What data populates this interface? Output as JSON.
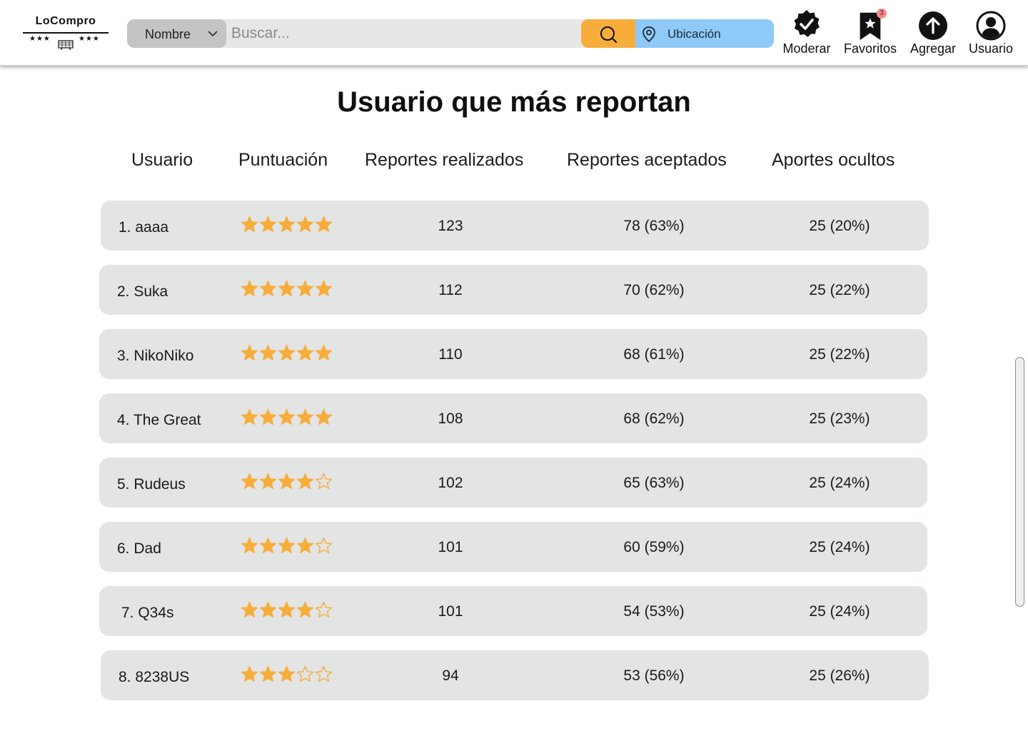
{
  "brand": {
    "name": "LoCompro",
    "stars_left": "★★★",
    "stars_right": "★★★"
  },
  "search": {
    "category": "Nombre",
    "placeholder": "Buscar...",
    "value": "",
    "location_label": "Ubicación"
  },
  "nav": {
    "moderar": "Moderar",
    "favoritos": "Favoritos",
    "favoritos_badge": "3",
    "agregar": "Agregar",
    "usuario": "Usuario"
  },
  "colors": {
    "search_button": "#f7ad3b",
    "location": "#8fc9f7",
    "star": "#f7ad3b",
    "row_bg": "#e3e4e4"
  },
  "page": {
    "title": "Usuario que más reportan"
  },
  "table": {
    "columns": [
      "Usuario",
      "Puntuación",
      "Reportes realizados",
      "Reportes aceptados",
      "Aportes ocultos"
    ],
    "rows": [
      {
        "usuario": "1. aaaa",
        "rating": 5,
        "realizados": "123",
        "aceptados": "78 (63%)",
        "ocultos": "25 (20%)"
      },
      {
        "usuario": "2. Suka",
        "rating": 5,
        "realizados": "112",
        "aceptados": "70 (62%)",
        "ocultos": "25 (22%)"
      },
      {
        "usuario": "3. NikoNiko",
        "rating": 5,
        "realizados": "110",
        "aceptados": "68 (61%)",
        "ocultos": "25 (22%)"
      },
      {
        "usuario": "4. The Great",
        "rating": 5,
        "realizados": "108",
        "aceptados": "68 (62%)",
        "ocultos": "25 (23%)"
      },
      {
        "usuario": "5. Rudeus",
        "rating": 4,
        "realizados": "102",
        "aceptados": "65 (63%)",
        "ocultos": "25 (24%)"
      },
      {
        "usuario": "6. Dad",
        "rating": 4,
        "realizados": "101",
        "aceptados": "60 (59%)",
        "ocultos": "25 (24%)"
      },
      {
        "usuario": "7. Q34s",
        "rating": 4,
        "realizados": "101",
        "aceptados": "54 (53%)",
        "ocultos": "25 (24%)"
      },
      {
        "usuario": "8. 8238US",
        "rating": 3,
        "realizados": "94",
        "aceptados": "53 (56%)",
        "ocultos": "25 (26%)"
      }
    ]
  }
}
